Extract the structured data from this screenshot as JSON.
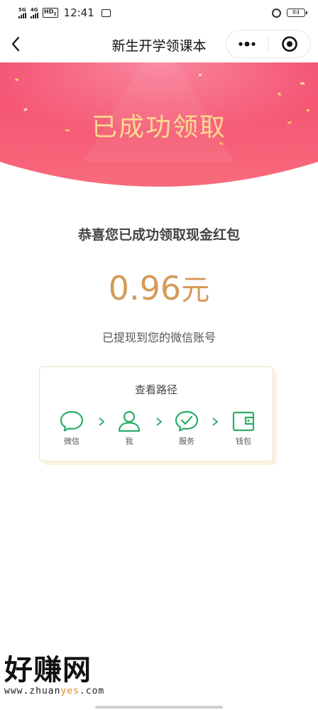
{
  "status_bar": {
    "net1": "5G",
    "net2": "4G",
    "hd": "HD",
    "hd_sub": "2",
    "time": "12:41",
    "battery": "84"
  },
  "nav": {
    "title": "新生开学领课本"
  },
  "banner": {
    "title": "已成功领取",
    "gradient_top": "#f34a6e",
    "gradient_bottom": "#f76a7d"
  },
  "main": {
    "congrats": "恭喜您已成功领取现金红包",
    "amount": "0.96",
    "amount_unit": "元",
    "note": "已提现到您的微信账号"
  },
  "path_card": {
    "title": "查看路径",
    "icon_color": "#2aae67",
    "steps": [
      {
        "label": "微信",
        "icon": "chat-bubble-icon"
      },
      {
        "label": "我",
        "icon": "person-icon"
      },
      {
        "label": "服务",
        "icon": "check-bubble-icon"
      },
      {
        "label": "钱包",
        "icon": "wallet-icon"
      }
    ]
  },
  "watermark": {
    "brand": "好赚网",
    "url_pre": "www.zhuan",
    "url_hl": "yes",
    "url_post": ".com"
  }
}
